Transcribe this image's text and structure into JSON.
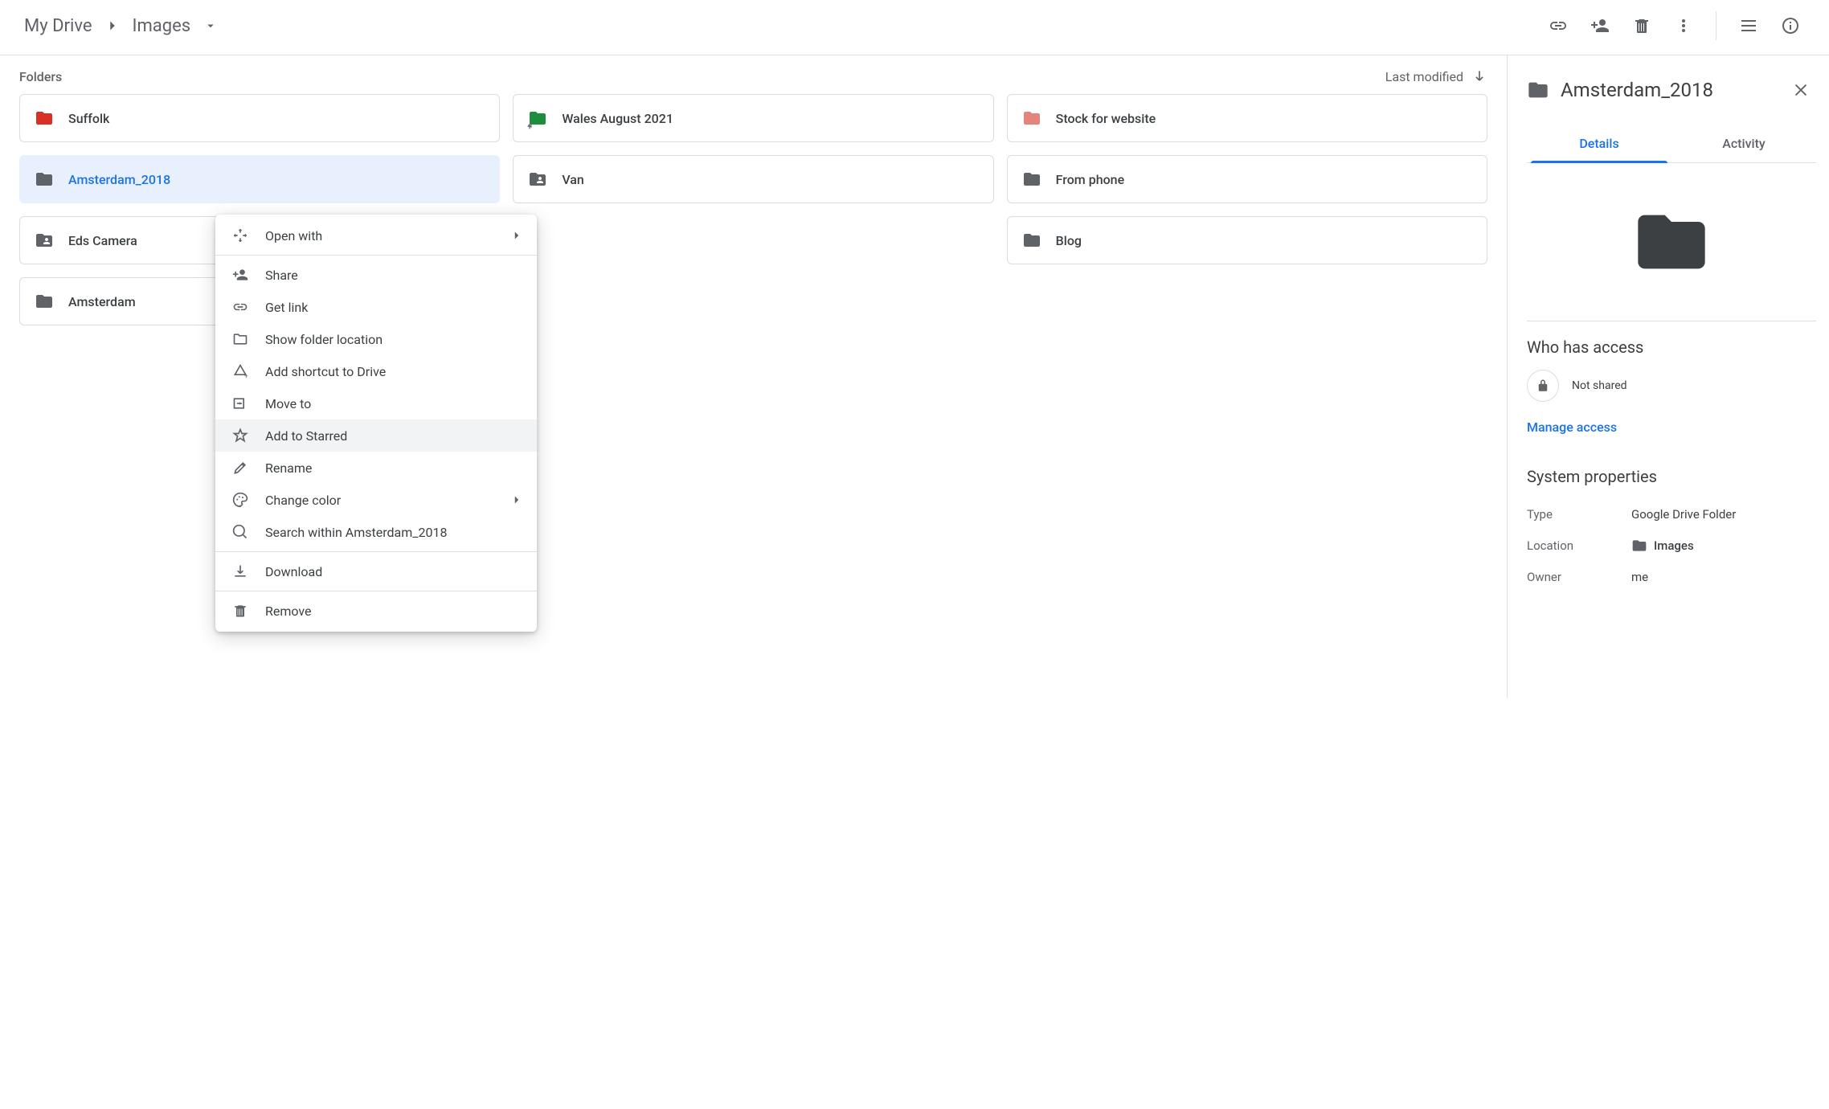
{
  "breadcrumb": {
    "root": "My Drive",
    "current": "Images"
  },
  "section": {
    "folders_label": "Folders",
    "sort_label": "Last modified"
  },
  "folders": [
    {
      "name": "Suffolk",
      "icon_color": "#d93025"
    },
    {
      "name": "Wales August 2021",
      "icon_color": "#1e8e3e",
      "shortcut": true
    },
    {
      "name": "Stock for website",
      "icon_color": "#e5847a"
    },
    {
      "name": "Amsterdam_2018",
      "icon_color": "#5f6368",
      "selected": true
    },
    {
      "name": "Van",
      "icon_color": "#5f6368",
      "shared": true
    },
    {
      "name": "From phone",
      "icon_color": "#5f6368"
    },
    {
      "name": "Eds Camera",
      "icon_color": "#5f6368",
      "shared": true
    },
    {
      "name": "__hidden__",
      "hole": true
    },
    {
      "name": "Blog",
      "icon_color": "#5f6368"
    },
    {
      "name": "Amsterdam",
      "icon_color": "#5f6368"
    }
  ],
  "context_menu": {
    "open_with": "Open with",
    "share": "Share",
    "get_link": "Get link",
    "show_location": "Show folder location",
    "add_shortcut": "Add shortcut to Drive",
    "move_to": "Move to",
    "add_starred": "Add to Starred",
    "rename": "Rename",
    "change_color": "Change color",
    "search_within": "Search within Amsterdam_2018",
    "download": "Download",
    "remove": "Remove"
  },
  "details": {
    "title": "Amsterdam_2018",
    "tab_details": "Details",
    "tab_activity": "Activity",
    "who_access": "Who has access",
    "not_shared": "Not shared",
    "manage": "Manage access",
    "sys_props": "System properties",
    "type_key": "Type",
    "type_val": "Google Drive Folder",
    "location_key": "Location",
    "location_val": "Images",
    "owner_key": "Owner",
    "owner_val": "me"
  }
}
